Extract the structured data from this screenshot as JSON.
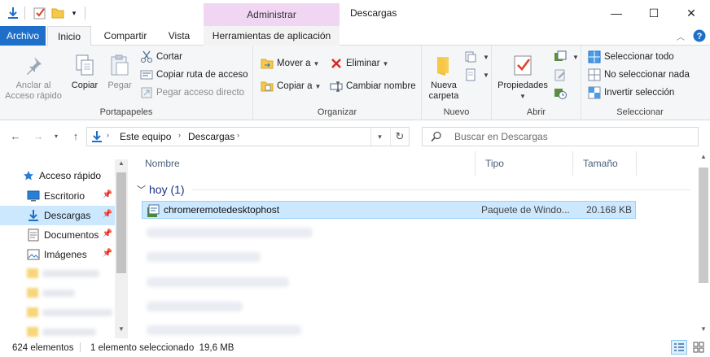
{
  "window": {
    "title": "Descargas",
    "context_header": "Administrar",
    "minimize_glyph": "—",
    "maximize_glyph": "☐",
    "close_glyph": "✕"
  },
  "tabs": {
    "archivo": "Archivo",
    "inicio": "Inicio",
    "compartir": "Compartir",
    "vista": "Vista",
    "herramientas": "Herramientas de aplicación"
  },
  "ribbon": {
    "portapapeles": {
      "label": "Portapapeles",
      "anclar": [
        "Anclar al",
        "Acceso rápido"
      ],
      "copiar": "Copiar",
      "pegar": "Pegar",
      "cortar": "Cortar",
      "copiar_ruta": "Copiar ruta de acceso",
      "pegar_acceso": "Pegar acceso directo"
    },
    "organizar": {
      "label": "Organizar",
      "mover": "Mover a",
      "copiar_a": "Copiar a",
      "eliminar": "Eliminar",
      "cambiar_nombre": "Cambiar nombre"
    },
    "nuevo": {
      "label": "Nuevo",
      "nueva_carpeta": [
        "Nueva",
        "carpeta"
      ]
    },
    "abrir": {
      "label": "Abrir",
      "propiedades": "Propiedades"
    },
    "seleccionar": {
      "label": "Seleccionar",
      "todo": "Seleccionar todo",
      "nada": "No seleccionar nada",
      "invertir": "Invertir selección"
    }
  },
  "address": {
    "segments": [
      "Este equipo",
      "Descargas"
    ],
    "search_placeholder": "Buscar en Descargas"
  },
  "navpane": {
    "items": [
      {
        "label": "Acceso rápido"
      },
      {
        "label": "Escritorio"
      },
      {
        "label": "Descargas"
      },
      {
        "label": "Documentos"
      },
      {
        "label": "Imágenes"
      }
    ]
  },
  "columns": {
    "nombre": "Nombre",
    "tipo": "Tipo",
    "tamano": "Tamaño"
  },
  "group": {
    "title": "hoy (1)"
  },
  "files": [
    {
      "name": "chromeremotedesktophost",
      "type": "Paquete de Windo...",
      "size": "20.168 KB"
    }
  ],
  "status": {
    "count": "624 elementos",
    "selection": "1 elemento seleccionado  19,6 MB"
  },
  "colors": {
    "accent": "#1e6fc9",
    "context_tab": "#f0d6f3",
    "selection": "#cce8ff",
    "selection_border": "#99d1ff"
  }
}
